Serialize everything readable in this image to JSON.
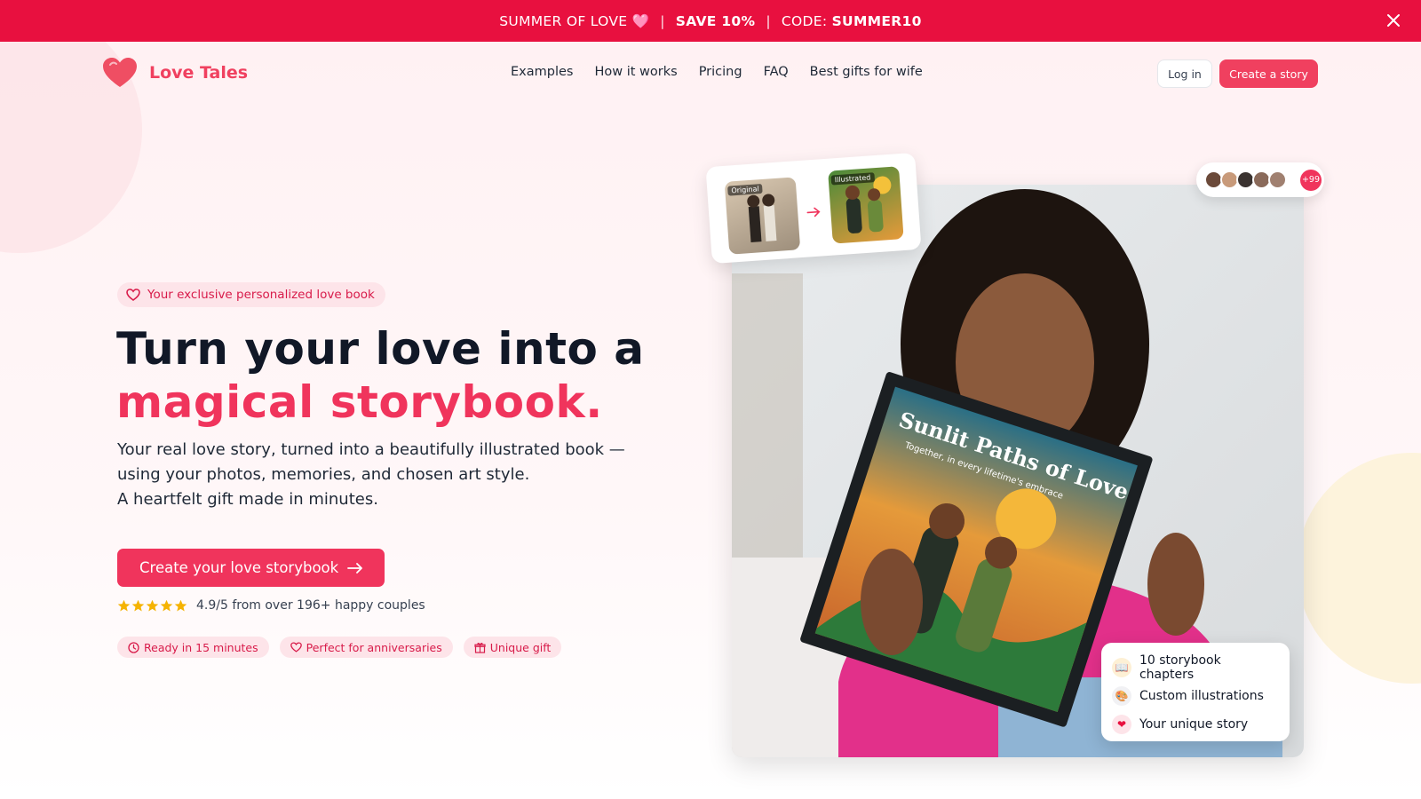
{
  "promo": {
    "prefix": "SUMMER OF LOVE",
    "emoji": "🩷",
    "sep1": "|",
    "discount": "SAVE 10%",
    "sep2": "|",
    "code_label": "CODE:",
    "code": "SUMMER10"
  },
  "nav": {
    "brand": "Love Tales",
    "links": [
      "Examples",
      "How it works",
      "Pricing",
      "FAQ",
      "Best gifts for wife"
    ],
    "login": "Log in",
    "create": "Create a story"
  },
  "hero": {
    "badge": "Your exclusive personalized love book",
    "title_line1": "Turn your love into a",
    "title_line2": "magical storybook.",
    "sub_line1": "Your real love story, turned into a beautifully illustrated book —",
    "sub_line2": "using your photos, memories, and chosen art style.",
    "sub_line3": "A heartfelt gift made in minutes.",
    "cta": "Create your love storybook",
    "rating_text": "4.9/5 from over 196+ happy couples",
    "rating_stars": 5,
    "pills": [
      "Ready in 15 minutes",
      "Perfect for anniversaries",
      "Unique gift"
    ]
  },
  "visual": {
    "original_tag": "Original",
    "illustrated_tag": "Illustrated",
    "book_title": "Sunlit Paths of Love",
    "book_subtitle": "Together, in every lifetime's embrace",
    "avatars_more": "+99",
    "features": [
      {
        "icon": "book-icon",
        "emoji": "📖",
        "label": "10 storybook chapters"
      },
      {
        "icon": "palette-icon",
        "emoji": "🎨",
        "label": "Custom illustrations"
      },
      {
        "icon": "heart-icon",
        "emoji": "❤",
        "label": "Your unique story"
      }
    ]
  },
  "colors": {
    "primary": "#f0345c",
    "promo_bg": "#e8103f",
    "text_dark": "#111827",
    "pill_bg": "#fde4e9",
    "star": "#f5b301"
  }
}
